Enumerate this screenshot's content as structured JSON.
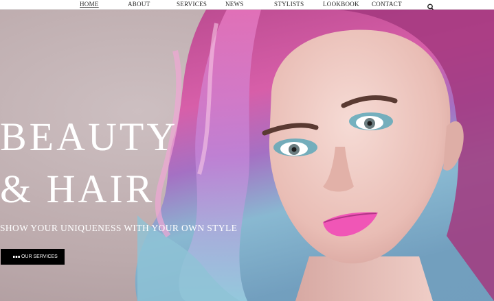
{
  "nav": {
    "items": [
      {
        "label": "HOME",
        "active": true
      },
      {
        "label": "ABOUT",
        "active": false
      },
      {
        "label": "SERVICES",
        "active": false
      },
      {
        "label": "NEWS",
        "active": false
      },
      {
        "label": "STYLISTS",
        "active": false
      },
      {
        "label": "LOOKBOOK",
        "active": false
      },
      {
        "label": "CONTACT",
        "active": false
      }
    ],
    "search_icon": "search-icon"
  },
  "hero": {
    "title_line1": "BEAUTY",
    "title_line2": "& HAIR",
    "tagline": "SHOW YOUR UNIQUENESS WITH YOUR OWN STYLE",
    "cta_label": "OUR SERVICES",
    "image": "woman-with-pastel-hair-image"
  },
  "colors": {
    "nav_bg": "#ffffff",
    "hero_text": "#ffffff",
    "cta_bg": "#000000",
    "lips": "#f056b6",
    "hair_pink": "#d64d9e",
    "hair_blue": "#8fc3d6"
  }
}
